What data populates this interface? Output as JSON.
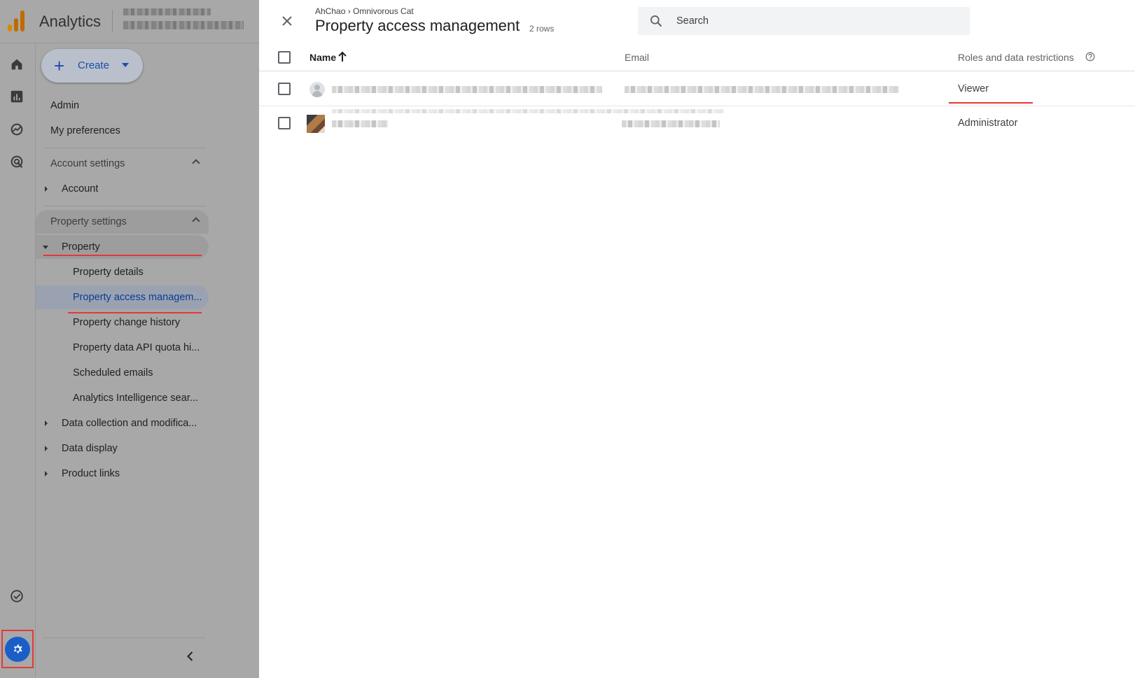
{
  "app": {
    "name": "Analytics",
    "logo_colors": [
      "#f9ab00",
      "#e37400",
      "#e37400"
    ]
  },
  "create": {
    "label": "Create"
  },
  "nav": {
    "admin": "Admin",
    "my_preferences": "My preferences",
    "account_settings": "Account settings",
    "account": "Account",
    "property_settings": "Property settings",
    "property": "Property",
    "property_children": [
      "Property details",
      "Property access managem...",
      "Property change history",
      "Property data API quota hi...",
      "Scheduled emails",
      "Analytics Intelligence sear..."
    ],
    "data_collection": "Data collection and modifica...",
    "data_display": "Data display",
    "product_links": "Product links"
  },
  "rail_icons": [
    "home-icon",
    "reports-icon",
    "explore-icon",
    "advertising-icon",
    "checklist-icon",
    "settings-gear-icon"
  ],
  "drawer": {
    "breadcrumb": "AhChao › Omnivorous Cat",
    "title": "Property access management",
    "row_count": "2 rows",
    "search_placeholder": "Search",
    "columns": {
      "name": "Name",
      "email": "Email",
      "roles": "Roles and data restrictions"
    },
    "rows": [
      {
        "role": "Viewer"
      },
      {
        "role": "Administrator"
      }
    ]
  },
  "colors": {
    "accent_blue": "#1a5fc8",
    "highlight_red": "#e53935",
    "active_item_text": "#0b3d91"
  }
}
